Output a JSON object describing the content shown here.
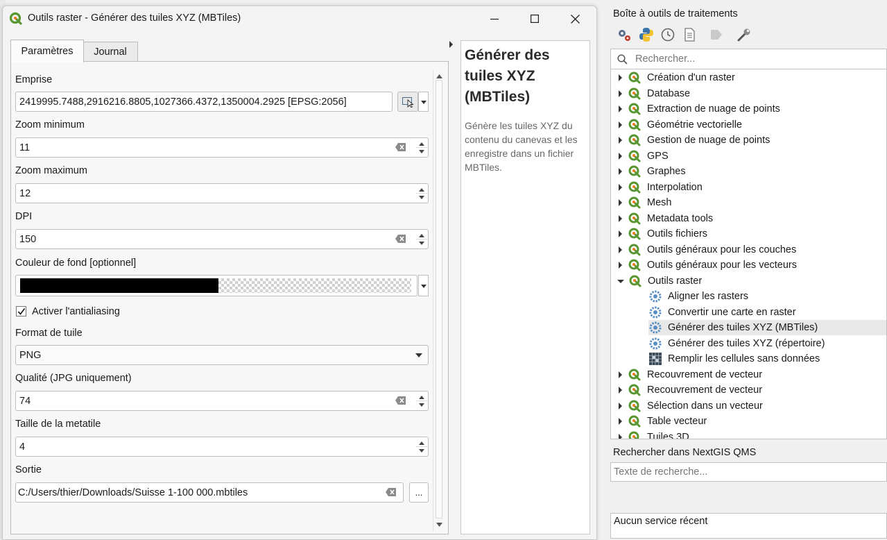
{
  "dialog": {
    "title": "Outils raster - Générer des tuiles XYZ (MBTiles)",
    "tabs": [
      "Paramètres",
      "Journal"
    ],
    "params": {
      "extent_label": "Emprise",
      "extent_value": "2419995.7488,2916216.8805,1027366.4372,1350004.2925 [EPSG:2056]",
      "zoom_min_label": "Zoom minimum",
      "zoom_min_value": "11",
      "zoom_max_label": "Zoom maximum",
      "zoom_max_value": "12",
      "dpi_label": "DPI",
      "dpi_value": "150",
      "bg_color_label": "Couleur de fond [optionnel]",
      "antialias_label": "Activer l'antialiasing",
      "tile_format_label": "Format de tuile",
      "tile_format_value": "PNG",
      "quality_label": "Qualité (JPG uniquement)",
      "quality_value": "74",
      "metatile_label": "Taille de la metatile",
      "metatile_value": "4",
      "output_label": "Sortie",
      "output_value": "C:/Users/thier/Downloads/Suisse 1-100 000.mbtiles",
      "browse_label": "..."
    },
    "help": {
      "title": "Générer des tuiles XYZ (MBTiles)",
      "description": "Génère les tuiles XYZ du contenu du canevas et les enregistre dans un fichier MBTiles."
    }
  },
  "toolbox": {
    "title": "Boîte à outils de traitements",
    "search_placeholder": "Rechercher...",
    "groups": [
      "Création d'un raster",
      "Database",
      "Extraction de nuage de points",
      "Géométrie vectorielle",
      "Gestion de nuage de points",
      "GPS",
      "Graphes",
      "Interpolation",
      "Mesh",
      "Metadata tools",
      "Outils fichiers",
      "Outils généraux pour les couches",
      "Outils généraux pour les vecteurs",
      "Outils raster"
    ],
    "raster_children": [
      "Aligner les rasters",
      "Convertir une carte en raster",
      "Générer des tuiles XYZ (MBTiles)",
      "Générer des tuiles XYZ (répertoire)",
      "Remplir les cellules sans données"
    ],
    "groups_after": [
      "Recouvrement de vecteur",
      "Recouvrement de vecteur",
      "Sélection dans un vecteur",
      "Table vecteur",
      "Tuiles 3D"
    ]
  },
  "qms": {
    "title": "Rechercher dans NextGIS QMS",
    "placeholder": "Texte de recherche...",
    "no_recent": "Aucun service récent"
  }
}
